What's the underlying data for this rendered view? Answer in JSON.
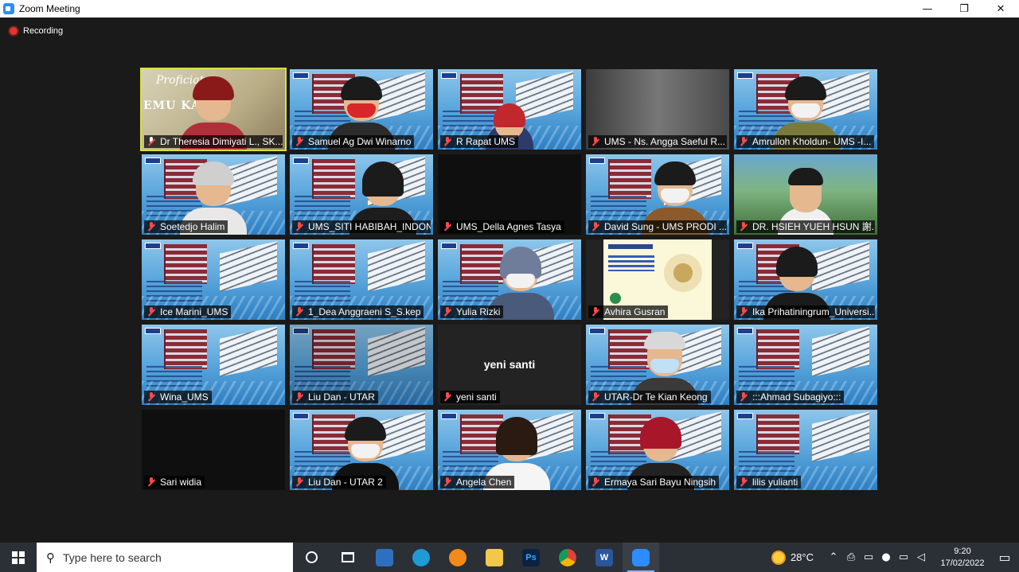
{
  "window": {
    "title": "Zoom Meeting",
    "minimize": "—",
    "restore": "❐",
    "close": "✕"
  },
  "recording": {
    "label": "Recording"
  },
  "participants": [
    {
      "name": "Dr Theresia Dimiyati L., SK...",
      "active": true
    },
    {
      "name": "Samuel Ag Dwi Winarno"
    },
    {
      "name": "R Rapat UMS"
    },
    {
      "name": "UMS - Ns. Angga Saeful R..."
    },
    {
      "name": "Amrulloh Kholdun- UMS -I..."
    },
    {
      "name": "Soetedjo Halim"
    },
    {
      "name": "UMS_SITI HABIBAH_INDON..."
    },
    {
      "name": "UMS_Della Agnes Tasya"
    },
    {
      "name": "David Sung - UMS PRODI ..."
    },
    {
      "name": "DR. HSIEH YUEH HSUN 謝..."
    },
    {
      "name": "Ice Marini_UMS"
    },
    {
      "name": "1_Dea Anggraeni S_S.kep"
    },
    {
      "name": "Yulia Rizki"
    },
    {
      "name": "Avhira Gusran"
    },
    {
      "name": "Ika Prihatiningrum_Universi..."
    },
    {
      "name": "Wina_UMS"
    },
    {
      "name": "Liu Dan - UTAR"
    },
    {
      "name": "yeni santi",
      "center_label": "yeni santi"
    },
    {
      "name": "UTAR-Dr Te Kian Keong"
    },
    {
      "name": ":::Ahmad Subagiyo:::"
    },
    {
      "name": "Sari widia"
    },
    {
      "name": "Liu Dan - UTAR 2"
    },
    {
      "name": "Angela Chen"
    },
    {
      "name": "Ermaya Sari Bayu Ningsih"
    },
    {
      "name": "lilis yulianti"
    }
  ],
  "first_tile": {
    "line1": "Proficiat",
    "line2": "EMU KANGE"
  },
  "taskbar": {
    "search_placeholder": "Type here to search",
    "temperature": "28°C",
    "time": "9:20",
    "date": "17/02/2022"
  }
}
